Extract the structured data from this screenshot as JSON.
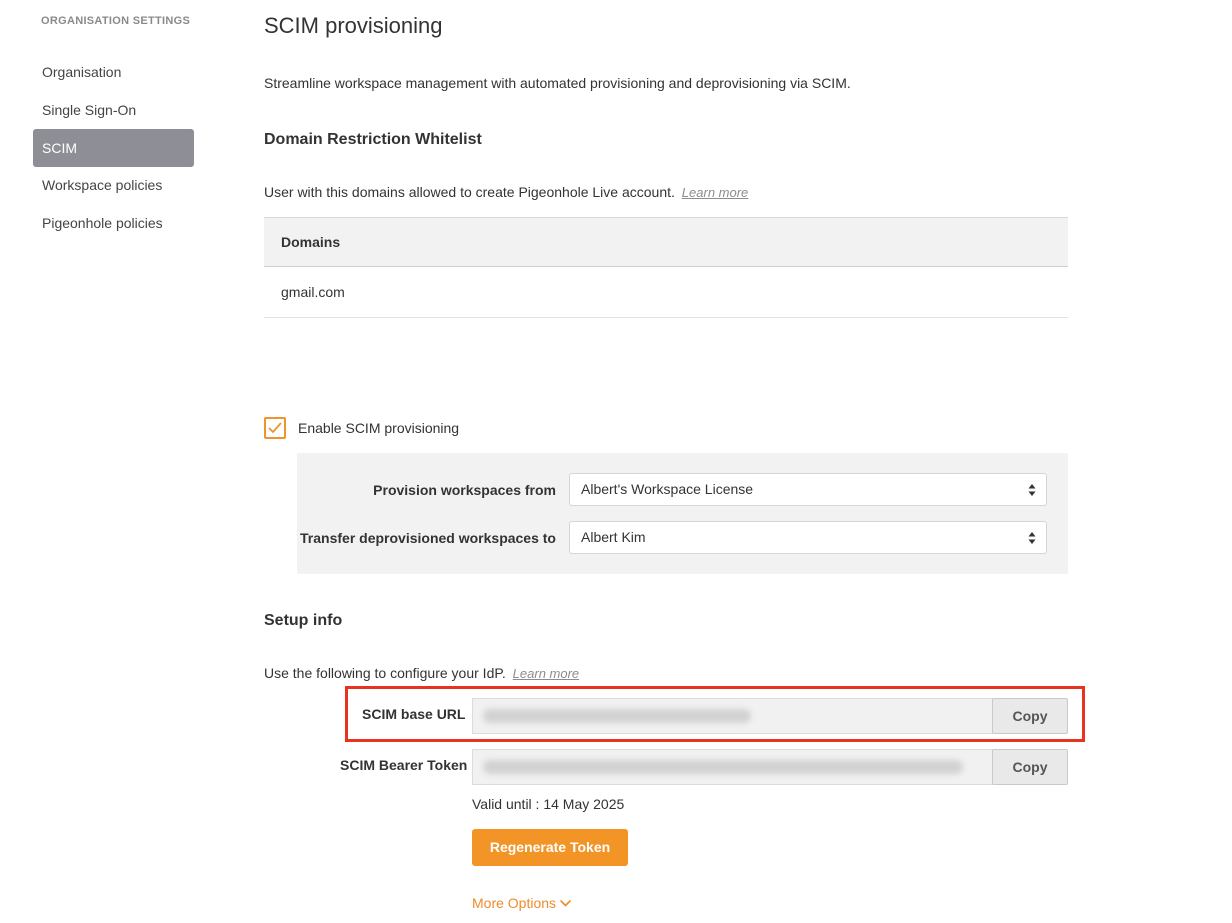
{
  "sidebar": {
    "heading": "ORGANISATION SETTINGS",
    "items": [
      {
        "label": "Organisation",
        "active": false
      },
      {
        "label": "Single Sign-On",
        "active": false
      },
      {
        "label": "SCIM",
        "active": true
      },
      {
        "label": "Workspace policies",
        "active": false
      },
      {
        "label": "Pigeonhole policies",
        "active": false
      }
    ]
  },
  "main": {
    "title": "SCIM provisioning",
    "description": "Streamline workspace management with automated provisioning and deprovisioning via SCIM.",
    "domain_section": {
      "title": "Domain Restriction Whitelist",
      "text": "User with this domains allowed to create Pigeonhole Live account.",
      "learn_more": "Learn more",
      "table_header": "Domains",
      "rows": [
        "gmail.com"
      ]
    },
    "enable_scim": {
      "label": "Enable SCIM provisioning",
      "checked": true
    },
    "provision_form": {
      "provision_from_label": "Provision workspaces from",
      "provision_from_value": "Albert's Workspace License",
      "transfer_to_label": "Transfer deprovisioned workspaces to",
      "transfer_to_value": "Albert Kim"
    },
    "setup_info": {
      "title": "Setup info",
      "text": "Use the following to configure your IdP.",
      "learn_more": "Learn more",
      "base_url_label": "SCIM base URL",
      "bearer_token_label": "SCIM Bearer Token",
      "copy_label": "Copy",
      "valid_until": "Valid until : 14 May 2025",
      "regenerate_label": "Regenerate Token",
      "more_options_label": "More Options"
    }
  },
  "colors": {
    "accent": "#f29426",
    "highlight": "#e8341f",
    "sidebar_active": "#8e8f96"
  }
}
